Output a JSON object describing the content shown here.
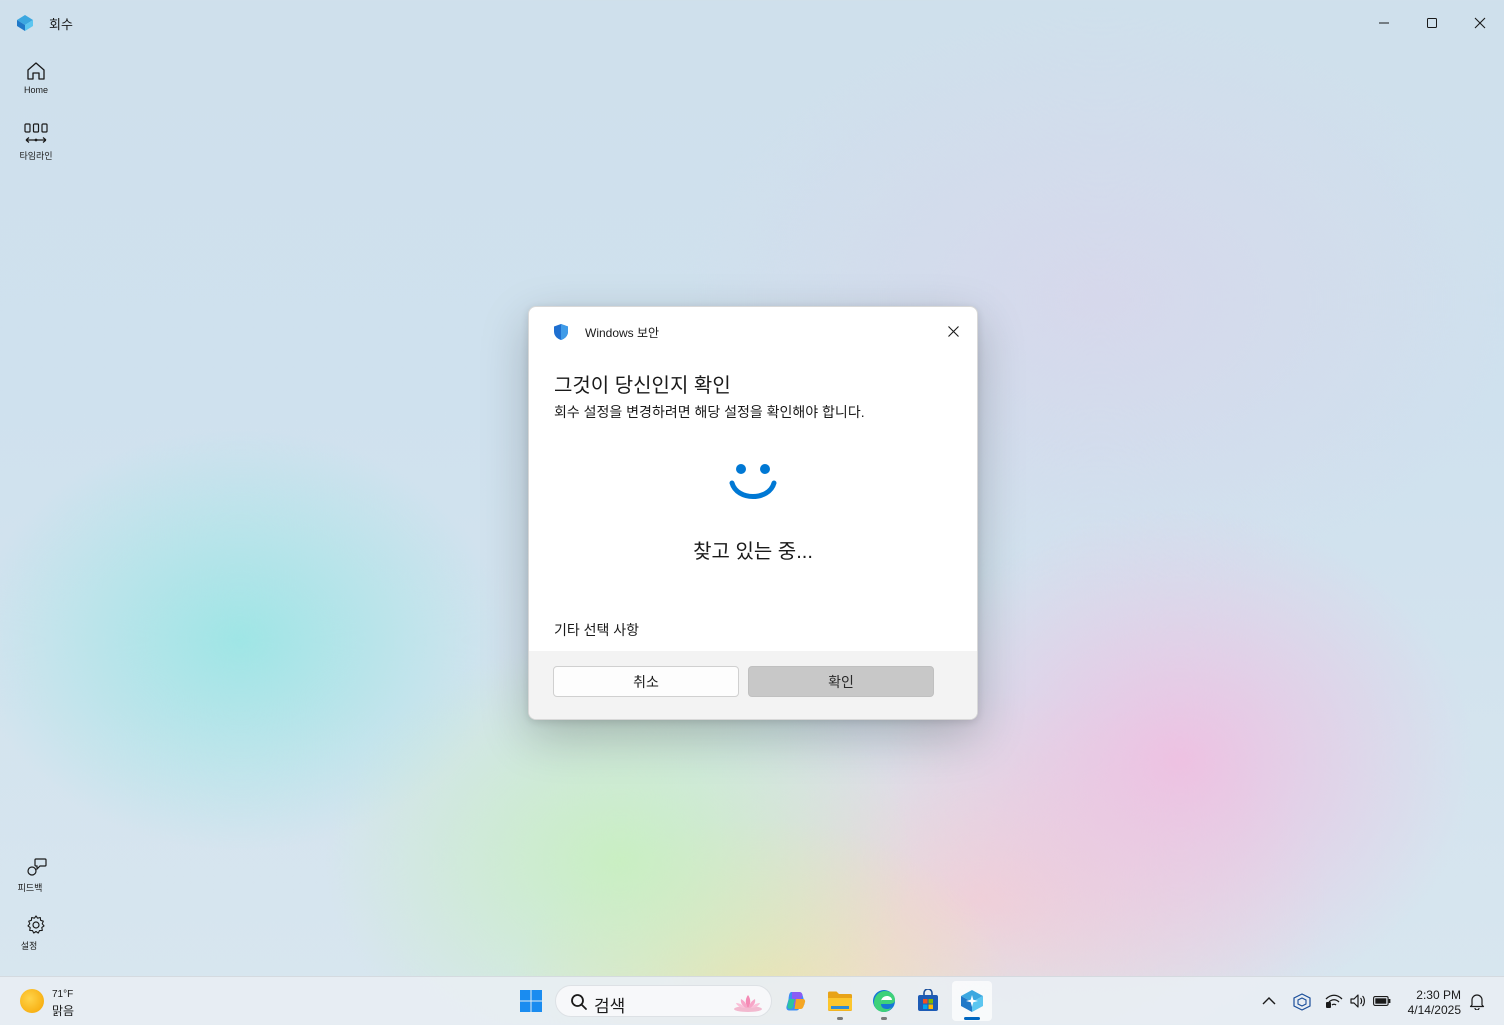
{
  "app": {
    "title": "회수"
  },
  "sidebar": {
    "items": [
      {
        "label": "Home",
        "icon": "home-icon"
      },
      {
        "label": "타임라인",
        "icon": "timeline-icon"
      }
    ],
    "bottom_items": [
      {
        "label": "피드백",
        "icon": "feedback-icon"
      },
      {
        "label": "설정",
        "icon": "gear-icon"
      }
    ]
  },
  "dialog": {
    "app_name": "Windows 보안",
    "heading": "그것이 당신인지 확인",
    "subtext": "회수 설정을 변경하려면 해당 설정을 확인해야 합니다.",
    "status": "찾고 있는 중...",
    "more_options": "기타 선택 사항",
    "cancel_label": "취소",
    "ok_label": "확인"
  },
  "taskbar": {
    "weather": {
      "temp": "71°F",
      "desc": "맑음"
    },
    "search": {
      "placeholder": "검색"
    },
    "clock": {
      "time": "2:30 PM",
      "date": "4/14/2025"
    }
  },
  "colors": {
    "accent": "#0067c0",
    "face": "#0078d4",
    "ok_disabled": "#c8c8c8"
  }
}
